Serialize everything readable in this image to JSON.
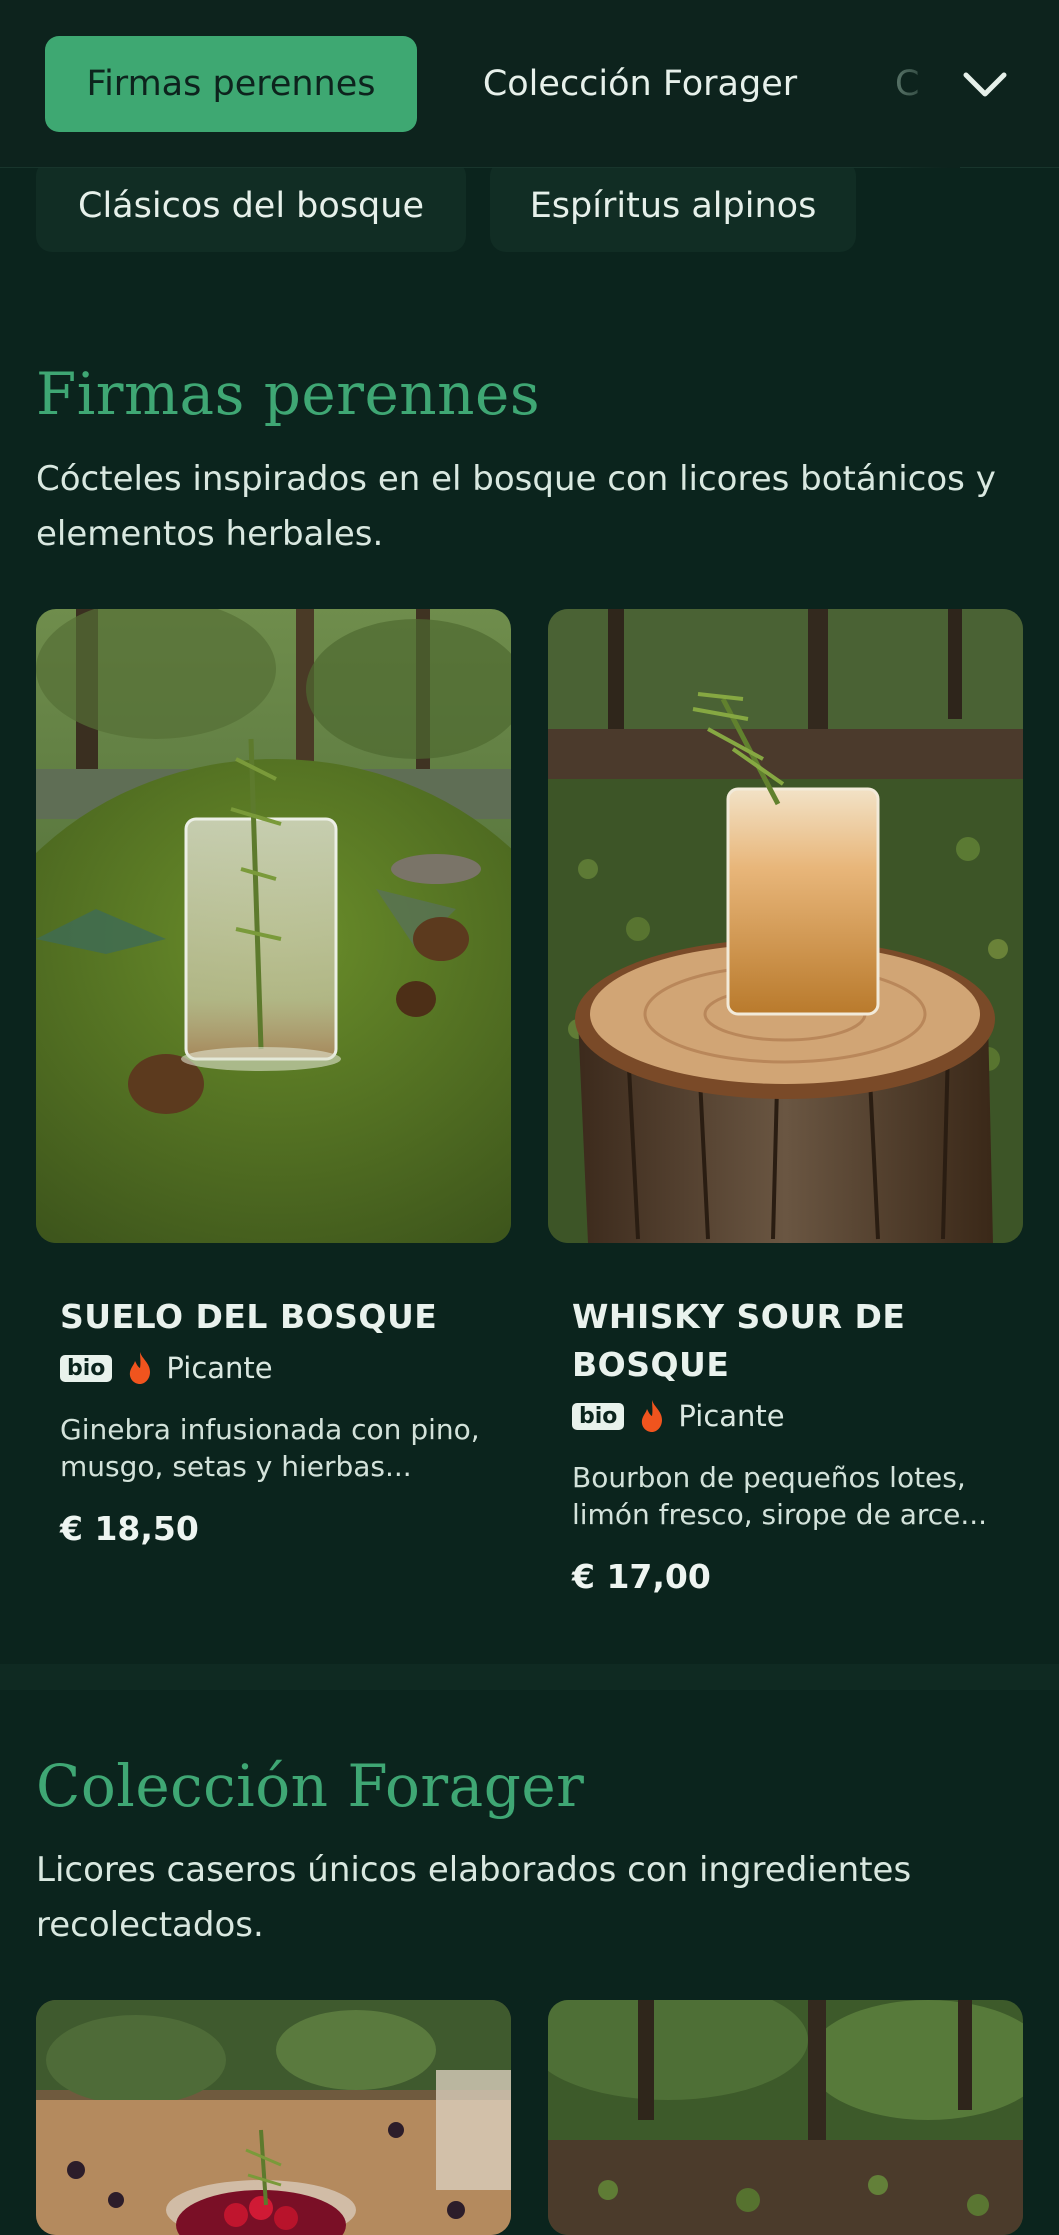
{
  "nav": {
    "tabs": [
      {
        "label": "Firmas perennes",
        "active": true
      },
      {
        "label": "Colección Forager",
        "active": false
      },
      {
        "label": "C",
        "active": false
      }
    ],
    "chips": [
      "Clásicos del bosque",
      "Espíritus alpinos"
    ],
    "expand_icon": "chevron-down-icon"
  },
  "sections": [
    {
      "title": "Firmas perennes",
      "description": "Cócteles inspirados en el bosque con licores botánicos y elementos herbales.",
      "items": [
        {
          "name": "SUELO DEL BOSQUE",
          "badge": "bio",
          "tag_icon": "flame-icon",
          "tag": "Picante",
          "description": "Ginebra infusionada con pino, musgo, setas y hierbas...",
          "price": "€ 18,50"
        },
        {
          "name": "WHISKY SOUR DE BOSQUE",
          "badge": "bio",
          "tag_icon": "flame-icon",
          "tag": "Picante",
          "description": "Bourbon de pequeños lotes, limón fresco, sirope de arce...",
          "price": "€ 17,00"
        }
      ]
    },
    {
      "title": "Colección Forager",
      "description": "Licores caseros únicos elaborados con ingredientes recolectados."
    }
  ],
  "colors": {
    "background": "#0b241d",
    "accent": "#3ea872",
    "flame": "#f0541e"
  }
}
